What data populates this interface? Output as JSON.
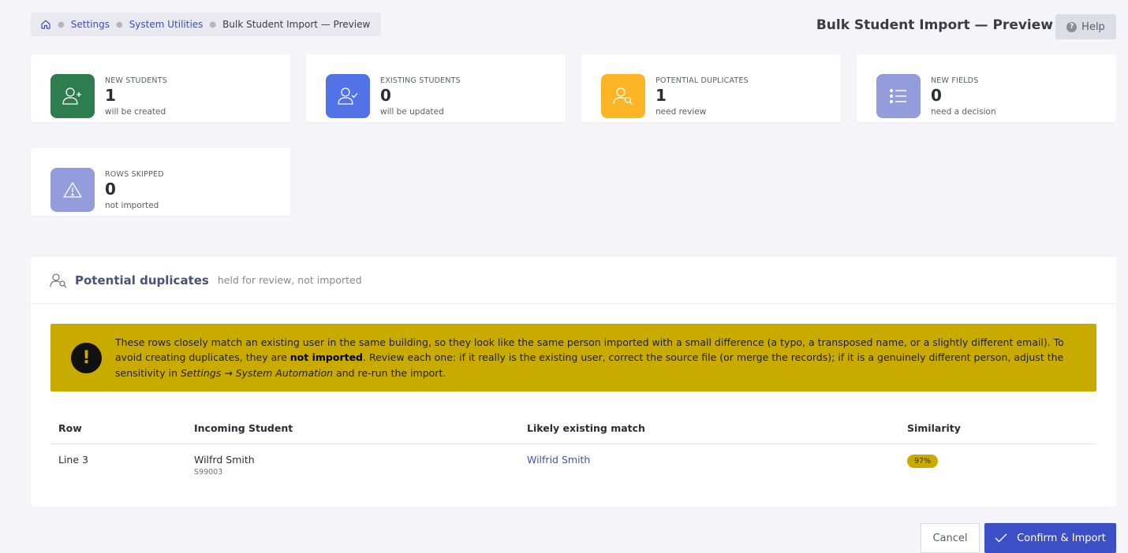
{
  "breadcrumb": {
    "home_icon": "home-icon",
    "items": [
      "Settings",
      "System Utilities"
    ],
    "current": "Bulk Student Import — Preview"
  },
  "header": {
    "title": "Bulk Student Import — Preview",
    "help_label": "Help",
    "help_icon": "question-circle-icon"
  },
  "stats": [
    {
      "label": "NEW STUDENTS",
      "value": "1",
      "sub": "will be created",
      "color": "#2e7d4f",
      "icon": "user-plus-icon"
    },
    {
      "label": "EXISTING STUDENTS",
      "value": "0",
      "sub": "will be updated",
      "color": "#5273e8",
      "icon": "user-check-icon"
    },
    {
      "label": "POTENTIAL DUPLICATES",
      "value": "1",
      "sub": "need review",
      "color": "#fbb524",
      "icon": "user-search-icon"
    },
    {
      "label": "NEW FIELDS",
      "value": "0",
      "sub": "need a decision",
      "color": "#939ddb",
      "icon": "list-icon"
    },
    {
      "label": "ROWS SKIPPED",
      "value": "0",
      "sub": "not imported",
      "color": "#939ddb",
      "icon": "warning-triangle-icon"
    }
  ],
  "duplicates": {
    "title": "Potential duplicates",
    "subtitle": "held for review, not imported",
    "alert": {
      "part1": "These rows closely match an existing user in the same building, so they look like the same person imported with a small difference (a typo, a transposed name, or a slightly different email). To avoid creating duplicates, they are ",
      "strong": "not imported",
      "part2": ". Review each one: if it really is the existing user, correct the source file (or merge the records); if it is a genuinely different person, adjust the sensitivity in ",
      "em": "Settings → System Automation",
      "part3": " and re-run the import."
    },
    "columns": [
      "Row",
      "Incoming Student",
      "Likely existing match",
      "Similarity"
    ],
    "rows": [
      {
        "row": "Line 3",
        "student_name": "Wilfrd Smith",
        "student_id": "S99003",
        "match": "Wilfrid Smith",
        "similarity": "97%"
      }
    ]
  },
  "footer": {
    "cancel_label": "Cancel",
    "confirm_label": "Confirm & Import",
    "confirm_icon": "check-icon"
  }
}
